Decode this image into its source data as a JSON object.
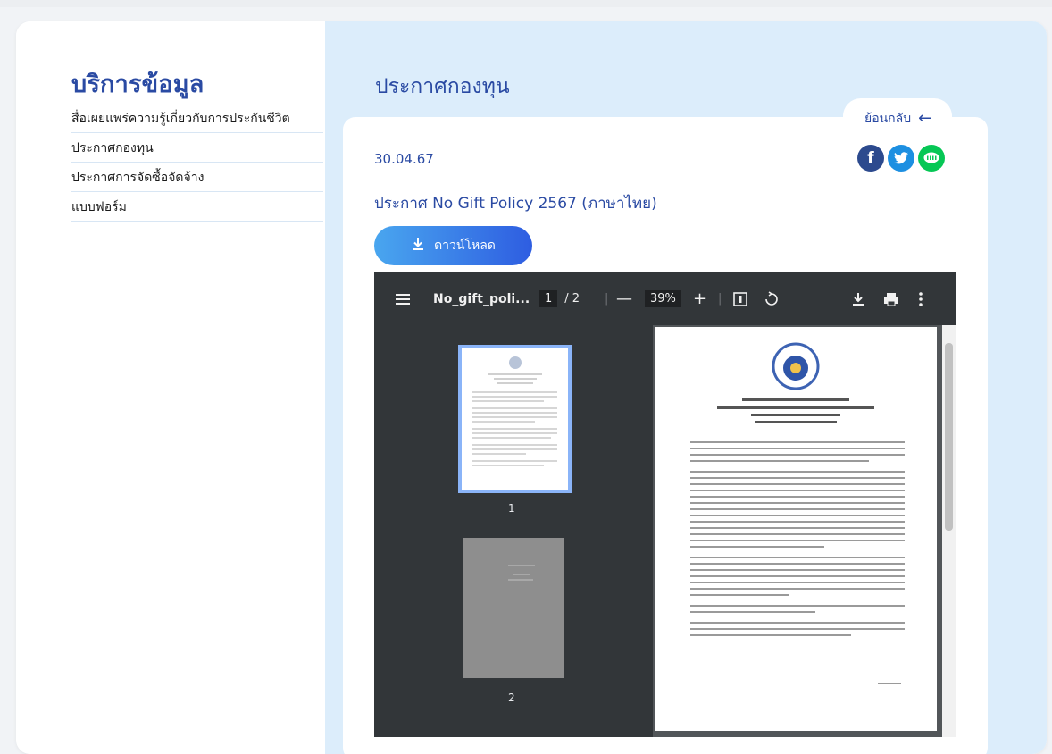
{
  "sidebar": {
    "title": "บริการข้อมูล",
    "items": [
      {
        "label": "สื่อเผยแพร่ความรู้เกี่ยวกับการประกันชีวิต"
      },
      {
        "label": "ประกาศกองทุน"
      },
      {
        "label": "ประกาศการจัดซื้อจัดจ้าง"
      },
      {
        "label": "แบบฟอร์ม"
      }
    ]
  },
  "main": {
    "title": "ประกาศกองทุน",
    "back_label": "ย้อนกลับ",
    "date": "30.04.67",
    "doc_title": "ประกาศ No Gift Policy 2567 (ภาษาไทย)",
    "download_label": "ดาวน์โหลด",
    "share_icons": [
      "facebook-icon",
      "twitter-icon",
      "line-icon"
    ]
  },
  "pdf_viewer": {
    "file_name": "No_gift_poli...",
    "current_page": "1",
    "total_pages": "/ 2",
    "zoom": "39%",
    "thumbnails": [
      {
        "label": "1"
      },
      {
        "label": "2"
      }
    ]
  },
  "colors": {
    "accent": "#2a4aa3",
    "main_bg": "#dcedfb",
    "toolbar": "#323639",
    "facebook": "#2c4a8e",
    "twitter": "#1d8fe1",
    "line": "#06c755"
  }
}
